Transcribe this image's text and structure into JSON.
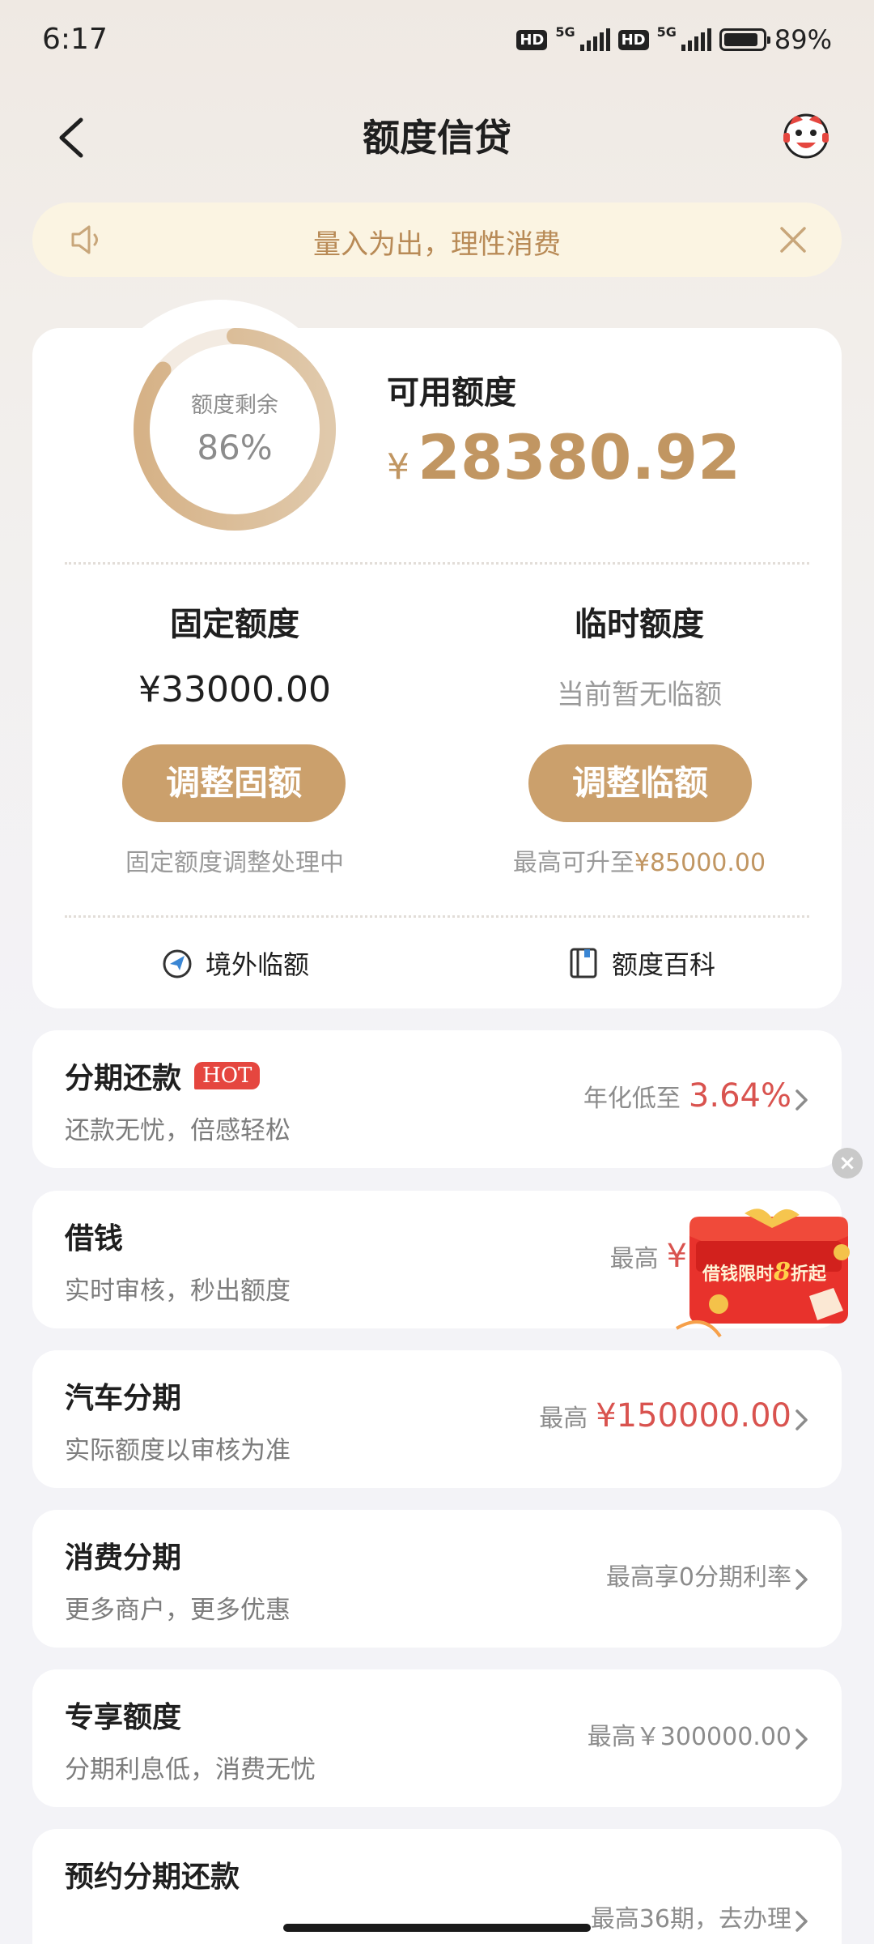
{
  "status_bar": {
    "time": "6:17",
    "hd1": "HD",
    "g1": "5G",
    "hd2": "HD",
    "g2": "5G",
    "battery": "89%"
  },
  "nav": {
    "title": "额度信贷"
  },
  "notice": {
    "text": "量入为出，理性消费"
  },
  "credit": {
    "ring_label": "额度剩余",
    "ring_percent_text": "86%",
    "ring_fraction": 0.86,
    "available_label": "可用额度",
    "currency": "¥",
    "available_amount": "28380.92",
    "fixed": {
      "title": "固定额度",
      "amount": "¥33000.00",
      "button": "调整固额",
      "note": "固定额度调整处理中"
    },
    "temp": {
      "title": "临时额度",
      "status": "当前暂无临额",
      "button": "调整临额",
      "note_prefix": "最高可升至",
      "note_amount": "¥85000.00"
    },
    "links": {
      "overseas": "境外临额",
      "wiki": "额度百科"
    }
  },
  "list": [
    {
      "title": "分期还款",
      "badge": "HOT",
      "subtitle": "还款无忧，倍感轻松",
      "right_prefix": "年化低至",
      "right_value": "3.64%"
    },
    {
      "title": "借钱",
      "subtitle": "实时审核，秒出额度",
      "right_prefix": "最高",
      "right_value": "¥16"
    },
    {
      "title": "汽车分期",
      "subtitle": "实际额度以审核为准",
      "right_prefix": "最高",
      "right_value": "¥150000.00"
    },
    {
      "title": "消费分期",
      "subtitle": "更多商户，更多优惠",
      "right_prefix": "最高享0分期利率",
      "right_value": ""
    },
    {
      "title": "专享额度",
      "subtitle": "分期利息低，消费无忧",
      "right_prefix": "最高￥300000.00",
      "right_value": ""
    },
    {
      "title": "预约分期还款",
      "subtitle": "",
      "right_prefix": "最高36期，去办理",
      "right_value": ""
    }
  ],
  "promo": {
    "text_a": "借钱限时",
    "text_num": "8",
    "text_b": "折起",
    "close": "×"
  },
  "colors": {
    "accent": "#c19662",
    "button": "#cba06c",
    "red": "#d9534f"
  }
}
